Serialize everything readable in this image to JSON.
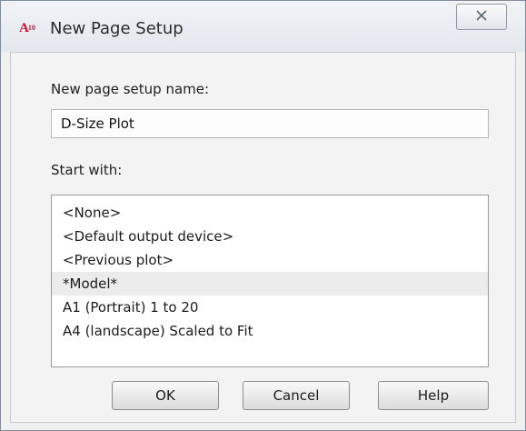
{
  "window": {
    "title": "New Page Setup",
    "app_icon": {
      "icon": "autocad-app-icon",
      "text": "A",
      "suffix": "10"
    },
    "close_glyph": "☒"
  },
  "form": {
    "name_label": "New page setup name:",
    "name_value": "D-Size Plot",
    "start_label": "Start with:",
    "start_options": [
      "<None>",
      "<Default output device>",
      "<Previous plot>",
      "*Model*",
      "A1 (Portrait) 1 to 20",
      "A4 (landscape) Scaled to Fit"
    ],
    "selected_option": "*Model*"
  },
  "buttons": {
    "ok": "OK",
    "cancel": "Cancel",
    "help": "Help"
  }
}
